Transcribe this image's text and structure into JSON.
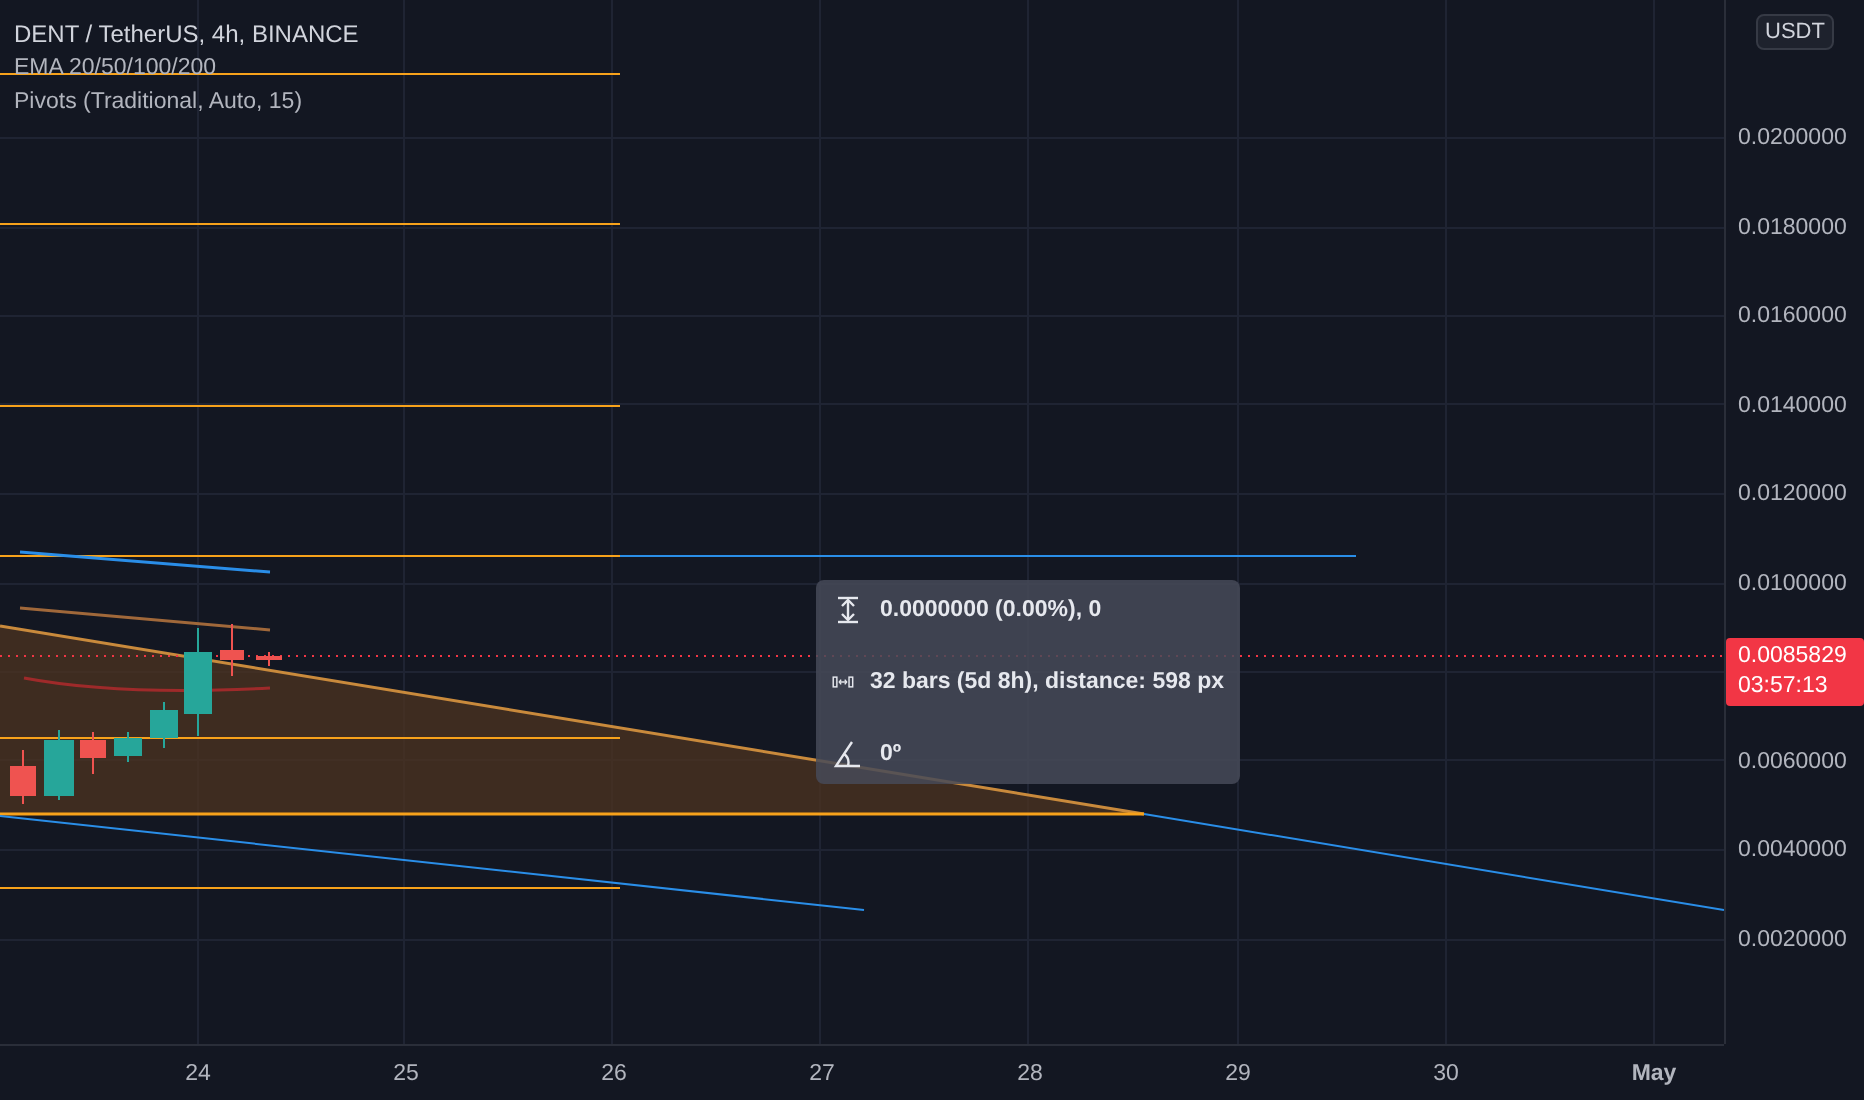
{
  "legend": {
    "title": "DENT / TetherUS, 4h, BINANCE",
    "indicators": [
      "EMA 20/50/100/200",
      "Pivots (Traditional, Auto, 15)"
    ]
  },
  "measure_tooltip": {
    "rows": [
      {
        "kind": "price",
        "text": "0.0000000 (0.00%), 0"
      },
      {
        "kind": "bars",
        "text": "32 bars (5d 8h), distance: 598 px"
      },
      {
        "kind": "angle",
        "text": "0º"
      }
    ]
  },
  "price_axis": {
    "currency": "USDT",
    "ticks_above": [
      "0.0200000",
      "0.0180000",
      "0.0160000",
      "0.0140000",
      "0.0120000",
      "0.0100000"
    ],
    "last_price": {
      "price": "0.0085829",
      "countdown": "03:57:13"
    },
    "ticks_below": [
      "0.0060000",
      "0.0040000",
      "0.0020000"
    ]
  },
  "time_axis": {
    "labels": [
      {
        "text": "24",
        "bold": false
      },
      {
        "text": "25",
        "bold": false
      },
      {
        "text": "26",
        "bold": false
      },
      {
        "text": "27",
        "bold": false
      },
      {
        "text": "28",
        "bold": false
      },
      {
        "text": "29",
        "bold": false
      },
      {
        "text": "30",
        "bold": false
      },
      {
        "text": "May",
        "bold": true
      }
    ]
  }
}
